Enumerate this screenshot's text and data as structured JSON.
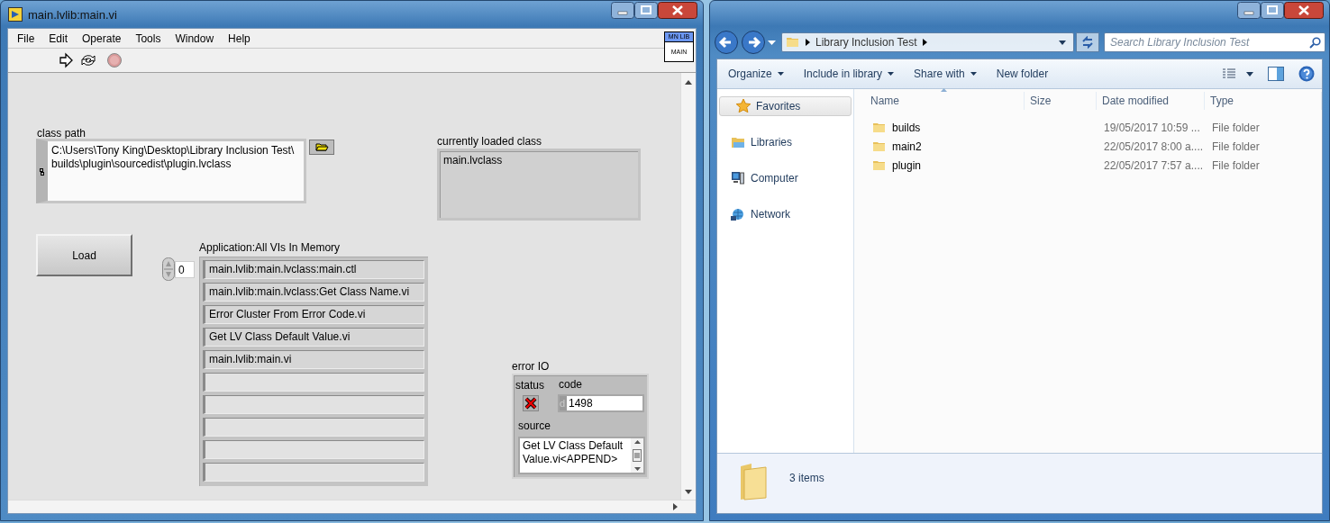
{
  "labview": {
    "title": "main.lvlib:main.vi",
    "menu": [
      "File",
      "Edit",
      "Operate",
      "Tools",
      "Window",
      "Help"
    ],
    "connector_icon": {
      "banner": "MN LIB",
      "label": "MAIN"
    },
    "class_path": {
      "label": "class path",
      "lines": [
        "C:\\Users\\Tony King\\Desktop\\Library Inclusion Test\\",
        "builds\\plugin\\sourcedist\\plugin.lvclass"
      ]
    },
    "loaded_class": {
      "label": "currently loaded class",
      "value": "main.lvclass"
    },
    "load_button": "Load",
    "vi_list": {
      "label": "Application:All VIs In Memory",
      "index": "0",
      "items": [
        "main.lvlib:main.lvclass:main.ctl",
        "main.lvlib:main.lvclass:Get Class Name.vi",
        "Error Cluster From Error Code.vi",
        "Get LV Class Default Value.vi",
        "main.lvlib:main.vi"
      ]
    },
    "error_io": {
      "label": "error IO",
      "status_label": "status",
      "status": true,
      "code_label": "code",
      "code_radix": "d",
      "code": "1498",
      "source_label": "source",
      "source": "Get LV Class Default Value.vi<APPEND>"
    }
  },
  "explorer": {
    "breadcrumb": "Library Inclusion Test",
    "search_placeholder": "Search Library Inclusion Test",
    "toolbar": [
      {
        "label": "Organize",
        "has_menu": true
      },
      {
        "label": "Include in library",
        "has_menu": true
      },
      {
        "label": "Share with",
        "has_menu": true
      },
      {
        "label": "New folder",
        "has_menu": false
      }
    ],
    "nav": [
      {
        "label": "Favorites",
        "kind": "favorites",
        "selected": true
      },
      {
        "label": "Libraries",
        "kind": "libraries",
        "selected": false
      },
      {
        "label": "Computer",
        "kind": "computer",
        "selected": false
      },
      {
        "label": "Network",
        "kind": "network",
        "selected": false
      }
    ],
    "columns": [
      "Name",
      "Size",
      "Date modified",
      "Type"
    ],
    "rows": [
      {
        "name": "builds",
        "date": "19/05/2017 10:59 ...",
        "type": "File folder"
      },
      {
        "name": "main2",
        "date": "22/05/2017 8:00 a....",
        "type": "File folder"
      },
      {
        "name": "plugin",
        "date": "22/05/2017 7:57 a....",
        "type": "File folder"
      }
    ],
    "status": "3 items"
  }
}
